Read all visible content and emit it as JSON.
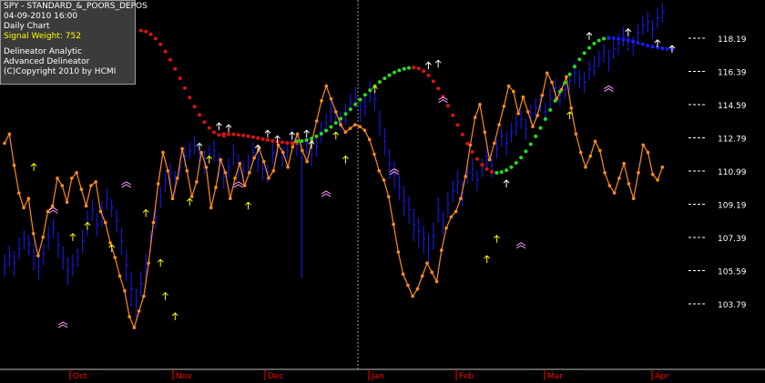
{
  "info": {
    "symbol": "SPY - STANDARD_&_POORS_DEPOS",
    "datetime": "04-09-2010  16:00",
    "period": "Daily Chart",
    "signal_weight": "Signal Weight: 752",
    "line1": "Delineator Analytic",
    "line2": "Advanced Delineator",
    "line3": "(C)Copyright 2010 by HCMI"
  },
  "colors": {
    "background": "#000000",
    "bars": "#1a1aff",
    "oscillator": "#ff8c1a",
    "delineator_up": "#22dd22",
    "delineator_down": "#dd1111",
    "delineator_neutral": "#1a1aff",
    "grid_text": "#ffffff",
    "month_text": "#ff0000",
    "signal_up": "#ffffff",
    "signal_yellow": "#ffff00",
    "signal_pink": "#ff99ff"
  },
  "chart_data": {
    "type": "bar",
    "title": "SPY - STANDARD_&_POORS_DEPOS",
    "y_ticks": [
      118.19,
      116.39,
      114.59,
      112.79,
      110.99,
      109.19,
      107.39,
      105.59,
      103.79
    ],
    "ylim": [
      101.9,
      120.6
    ],
    "months": [
      "Oct",
      "Nov",
      "Dec",
      "Jan",
      "Feb",
      "Mar",
      "Apr"
    ],
    "num_bars": 138,
    "close": [
      105.9,
      106.4,
      106.0,
      106.8,
      107.3,
      107.0,
      106.4,
      105.8,
      106.5,
      107.4,
      107.9,
      107.0,
      106.3,
      105.6,
      105.9,
      106.3,
      107.2,
      108.2,
      108.9,
      108.1,
      108.7,
      109.5,
      109.0,
      108.3,
      107.2,
      105.9,
      104.6,
      103.9,
      104.9,
      105.9,
      107.2,
      108.5,
      109.6,
      110.4,
      110.9,
      110.4,
      111.2,
      111.8,
      112.1,
      112.4,
      111.9,
      111.5,
      111.9,
      112.1,
      111.3,
      110.7,
      111.2,
      111.9,
      111.3,
      111.0,
      111.4,
      112.0,
      111.6,
      111.1,
      110.9,
      112.0,
      112.3,
      111.8,
      112.1,
      112.8,
      112.4,
      112.1,
      112.5,
      111.9,
      112.3,
      113.1,
      113.6,
      114.2,
      114.0,
      113.7,
      114.1,
      114.7,
      115.0,
      114.3,
      114.5,
      115.3,
      114.9,
      113.6,
      112.6,
      111.4,
      110.8,
      110.1,
      109.4,
      108.9,
      108.1,
      107.7,
      107.3,
      106.8,
      107.5,
      108.9,
      108.2,
      109.2,
      109.9,
      110.4,
      109.8,
      110.9,
      111.1,
      110.5,
      111.2,
      111.8,
      111.3,
      112.2,
      112.9,
      112.5,
      113.1,
      113.5,
      113.8,
      113.3,
      114.1,
      114.4,
      114.7,
      114.2,
      114.9,
      115.5,
      115.1,
      115.4,
      115.9,
      116.3,
      116.0,
      115.8,
      116.5,
      116.7,
      117.1,
      117.4,
      117.0,
      117.6,
      117.9,
      118.3,
      118.1,
      117.8,
      118.5,
      118.9,
      119.1,
      118.7,
      119.3,
      119.6
    ],
    "range": [
      1.1,
      1.0,
      1.2,
      1.1,
      0.9,
      1.0,
      1.3,
      1.2,
      1.0,
      1.1,
      0.9,
      1.2,
      1.1,
      1.3,
      1.0,
      0.9,
      1.1,
      1.2,
      1.0,
      1.1,
      1.2,
      1.0,
      0.9,
      1.1,
      1.3,
      1.5,
      1.6,
      1.4,
      1.2,
      1.1,
      1.0,
      1.1,
      1.0,
      0.9,
      1.0,
      1.1,
      0.9,
      1.0,
      0.8,
      0.9,
      1.0,
      1.1,
      0.9,
      1.0,
      1.2,
      1.1,
      0.9,
      1.0,
      1.1,
      1.0,
      0.9,
      1.0,
      1.1,
      1.0,
      0.9,
      1.0,
      0.9,
      1.0,
      0.8,
      0.9,
      1.0,
      0.9,
      1.0,
      1.1,
      0.9,
      1.0,
      0.9,
      1.0,
      0.8,
      0.9,
      1.0,
      0.9,
      1.0,
      1.1,
      0.9,
      1.0,
      1.1,
      1.2,
      1.3,
      1.4,
      1.3,
      1.2,
      1.4,
      1.3,
      1.5,
      1.4,
      1.3,
      1.4,
      1.3,
      1.2,
      1.1,
      1.2,
      1.0,
      1.1,
      1.2,
      1.0,
      1.1,
      1.0,
      0.9,
      1.0,
      1.1,
      0.9,
      1.0,
      1.1,
      0.9,
      1.0,
      0.9,
      1.0,
      0.9,
      1.0,
      0.8,
      0.9,
      1.0,
      0.9,
      1.0,
      0.8,
      0.9,
      1.0,
      0.9,
      1.0,
      0.9,
      1.0,
      0.8,
      0.9,
      1.0,
      0.9,
      1.0,
      0.9,
      1.0,
      0.9,
      0.8,
      0.9,
      1.0,
      0.9,
      1.0,
      0.9
    ],
    "delineator": [
      {
        "from": 72,
        "to": 78,
        "state": "none"
      },
      {
        "from": 0,
        "to": 0,
        "state": "none"
      }
    ],
    "oscillator": [
      112.5,
      113.0,
      111.3,
      109.8,
      109.0,
      109.5,
      107.6,
      106.4,
      107.4,
      108.8,
      109.1,
      110.6,
      110.2,
      109.3,
      110.6,
      110.9,
      110.0,
      109.1,
      110.2,
      110.4,
      108.8,
      108.2,
      107.1,
      106.3,
      105.3,
      104.5,
      103.1,
      102.5,
      103.4,
      104.2,
      106.0,
      108.2,
      110.3,
      112.0,
      111.0,
      109.5,
      110.6,
      112.2,
      111.0,
      109.6,
      110.4,
      112.0,
      111.2,
      109.0,
      110.1,
      111.6,
      110.9,
      109.5,
      110.6,
      111.4,
      110.2,
      110.9,
      111.7,
      112.2,
      111.5,
      110.6,
      111.0,
      112.4,
      112.0,
      111.2,
      112.3,
      113.0,
      112.1,
      111.5,
      112.6,
      113.7,
      114.8,
      115.6,
      114.9,
      114.2,
      113.5,
      113.1,
      113.3,
      113.5,
      113.4,
      113.2,
      112.7,
      111.9,
      111.0,
      110.5,
      109.6,
      108.1,
      106.6,
      105.4,
      104.8,
      104.2,
      104.6,
      105.3,
      106.0,
      105.5,
      105.0,
      106.7,
      107.9,
      108.5,
      108.8,
      109.5,
      110.7,
      112.4,
      113.9,
      114.6,
      113.1,
      111.6,
      112.5,
      113.5,
      114.5,
      115.6,
      115.3,
      114.1,
      115.0,
      114.2,
      113.4,
      114.0,
      115.1,
      116.3,
      115.8,
      114.9,
      115.4,
      116.1,
      114.4,
      113.0,
      112.0,
      111.2,
      111.8,
      112.6,
      112.1,
      110.9,
      110.2,
      109.8,
      110.6,
      111.4,
      110.3,
      109.5,
      110.9,
      112.4,
      112.0,
      110.8,
      110.5,
      111.2
    ],
    "tick_labels_note": "right axis price levels"
  }
}
